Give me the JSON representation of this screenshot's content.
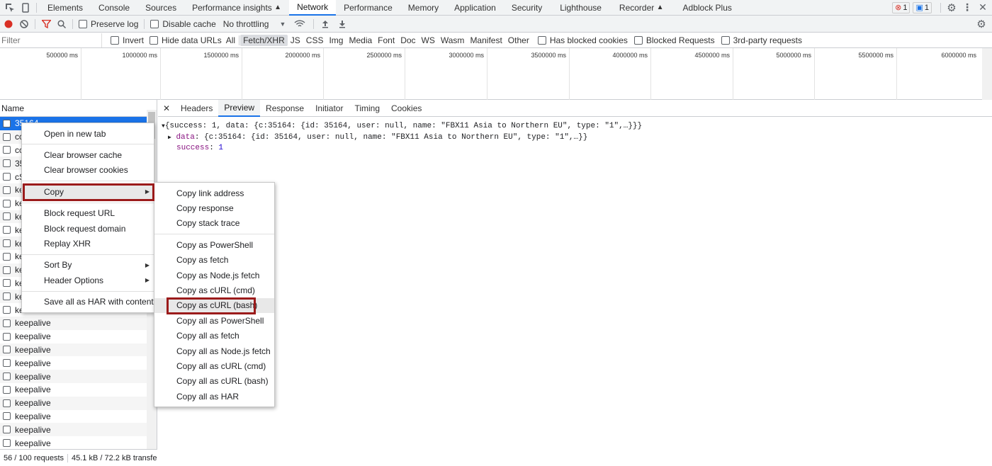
{
  "topbar": {
    "tabs": [
      "Elements",
      "Console",
      "Sources",
      "Performance insights",
      "Network",
      "Performance",
      "Memory",
      "Application",
      "Security",
      "Lighthouse",
      "Recorder",
      "Adblock Plus"
    ],
    "active_tab": "Network",
    "error_count": "1",
    "message_count": "1"
  },
  "toolbar": {
    "preserve_log": "Preserve log",
    "disable_cache": "Disable cache",
    "throttling": "No throttling"
  },
  "filterbar": {
    "placeholder": "Filter",
    "invert": "Invert",
    "hide_data_urls": "Hide data URLs",
    "types": [
      "All",
      "Fetch/XHR",
      "JS",
      "CSS",
      "Img",
      "Media",
      "Font",
      "Doc",
      "WS",
      "Wasm",
      "Manifest",
      "Other"
    ],
    "selected_type": "Fetch/XHR",
    "has_blocked_cookies": "Has blocked cookies",
    "blocked_requests": "Blocked Requests",
    "third_party": "3rd-party requests"
  },
  "overview": {
    "ticks": [
      "500000 ms",
      "1000000 ms",
      "1500000 ms",
      "2000000 ms",
      "2500000 ms",
      "3000000 ms",
      "3500000 ms",
      "4000000 ms",
      "4500000 ms",
      "5000000 ms",
      "5500000 ms",
      "6000000 ms"
    ]
  },
  "requests": {
    "header": "Name",
    "rows": [
      "35164",
      "cc",
      "cc",
      "35",
      "cS",
      "ke",
      "ke",
      "ke",
      "ke",
      "ke",
      "ke",
      "ke",
      "ke",
      "ke",
      "ke",
      "keepalive",
      "keepalive",
      "keepalive",
      "keepalive",
      "keepalive",
      "keepalive",
      "keepalive",
      "keepalive",
      "keepalive",
      "keepalive",
      "keepalive"
    ],
    "status_requests": "56 / 100 requests",
    "status_transfer": "45.1 kB / 72.2 kB transferred"
  },
  "detail": {
    "tabs": [
      "Headers",
      "Preview",
      "Response",
      "Initiator",
      "Timing",
      "Cookies"
    ],
    "active_tab": "Preview",
    "preview_line1": "{success: 1, data: {c:35164: {id: 35164, user: null, name: \"FBX11 Asia to Northern EU\", type: \"1\",…}}}",
    "preview_line2_key": "data",
    "preview_line2_val": ": {c:35164: {id: 35164, user: null, name: \"FBX11 Asia to Northern EU\", type: \"1\",…}}",
    "preview_line3_key": "success",
    "preview_line3_val": "1"
  },
  "context_menu": {
    "items": [
      "Open in new tab",
      "Clear browser cache",
      "Clear browser cookies",
      "Copy",
      "Block request URL",
      "Block request domain",
      "Replay XHR",
      "Sort By",
      "Header Options",
      "Save all as HAR with content"
    ]
  },
  "copy_submenu": {
    "items": [
      "Copy link address",
      "Copy response",
      "Copy stack trace",
      "Copy as PowerShell",
      "Copy as fetch",
      "Copy as Node.js fetch",
      "Copy as cURL (cmd)",
      "Copy as cURL (bash)",
      "Copy all as PowerShell",
      "Copy all as fetch",
      "Copy all as Node.js fetch",
      "Copy all as cURL (cmd)",
      "Copy all as cURL (bash)",
      "Copy all as HAR"
    ]
  },
  "colors": {
    "accent": "#1a73e8",
    "highlight_box": "#9b1b1b",
    "error": "#d93025"
  }
}
